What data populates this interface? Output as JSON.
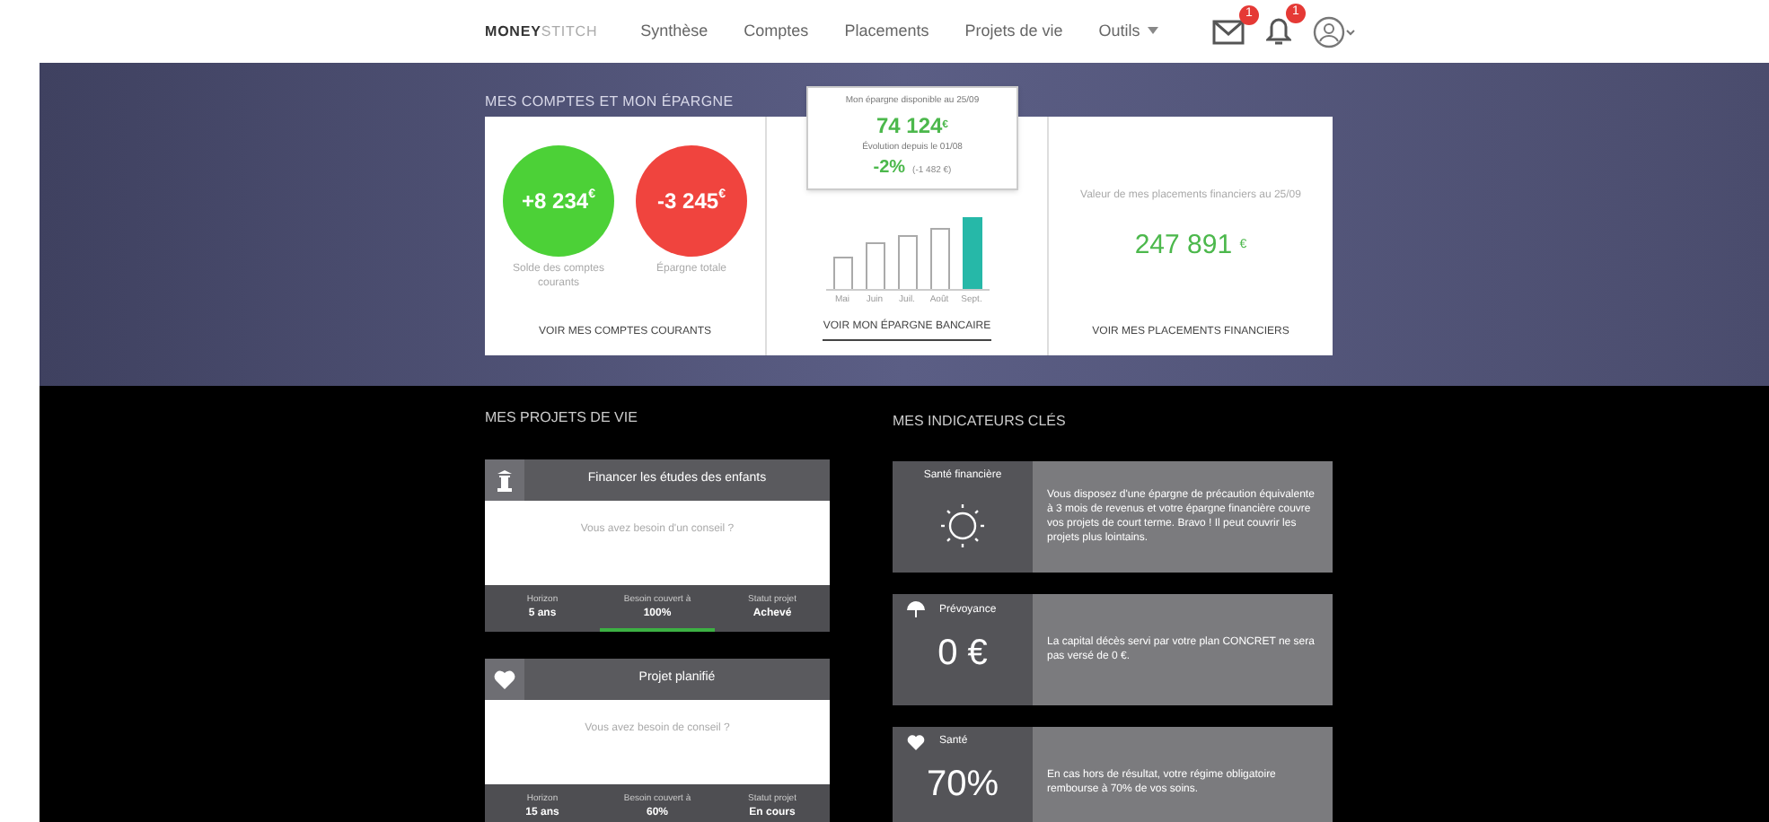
{
  "nav": {
    "logo": [
      "MONEY",
      "STITCH"
    ],
    "items": [
      {
        "label": "Synthèse",
        "selected": false
      },
      {
        "label": "Comptes",
        "selected": false
      },
      {
        "label": "Placements",
        "selected": false
      },
      {
        "label": "Projets de vie",
        "selected": false
      },
      {
        "label": "Outils",
        "selected": false
      }
    ],
    "badges": [
      "1",
      "1"
    ]
  },
  "accounts": {
    "title": "MES COMPTES ET MON ÉPARGNE",
    "balances": [
      {
        "amount": "+8 234",
        "currency": "€",
        "color": "#4cd137",
        "label": "Solde des comptes courants"
      },
      {
        "amount": "-3 245",
        "currency": "€",
        "color": "#f0443e",
        "label": "Épargne totale"
      }
    ],
    "balances_link": "VOIR MES COMPTES COURANTS",
    "tooltip": {
      "caption": "Mon épargne disponible au 25/09",
      "amount": "74 124",
      "currency": "€",
      "sub": "Évolution depuis le 01/08",
      "change": "-2%",
      "change_detail": "(-1 482 €)"
    },
    "months": [
      {
        "label": "Mai",
        "selected": false
      },
      {
        "label": "Juin",
        "selected": false
      },
      {
        "label": "Juil.",
        "selected": false
      },
      {
        "label": "Août",
        "selected": false
      },
      {
        "label": "Sept.",
        "selected": true
      }
    ],
    "savings_link": "VOIR MON ÉPARGNE BANCAIRE",
    "investments": {
      "label": "Valeur de mes placements financiers au 25/09",
      "amount": "247 891",
      "currency": "€"
    },
    "investments_link": "VOIR MES PLACEMENTS FINANCIERS"
  },
  "projects": {
    "title": "MES PROJETS DE VIE",
    "items": [
      {
        "kind": "education",
        "title": "Financer les études des enfants",
        "body": "Vous avez besoin d'un conseil ?",
        "stats": [
          {
            "label": "Horizon",
            "value": "5 ans"
          },
          {
            "label": "Besoin couvert à",
            "value": "100%",
            "level": 1
          },
          {
            "label": "Statut projet",
            "value": "Achevé"
          }
        ]
      },
      {
        "kind": "heart",
        "title": "Projet planifié",
        "body": "Vous avez besoin de conseil ?",
        "stats": [
          {
            "label": "Horizon",
            "value": "15 ans"
          },
          {
            "label": "Besoin couvert à",
            "value": "60%"
          },
          {
            "label": "Statut projet",
            "value": "En cours"
          }
        ]
      }
    ]
  },
  "indicators": {
    "title": "MES INDICATEURS CLÉS",
    "items": [
      {
        "kind": "sun",
        "title": "Santé financière",
        "text": "Vous disposez d'une épargne de précaution équivalente à 3 mois de revenus et votre épargne financière couvre vos projets de court terme. Bravo ! Il peut couvrir les projets plus lointains."
      },
      {
        "kind": "umbrella",
        "title": "Prévoyance",
        "value": "0 €",
        "text": "La capital décès servi par votre plan CONCRET ne sera pas versé de 0 €."
      },
      {
        "kind": "heart",
        "title": "Santé",
        "value": "70%",
        "text": "En cas hors de résultat, votre régime obligatoire rembourse à 70% de vos soins."
      }
    ]
  }
}
